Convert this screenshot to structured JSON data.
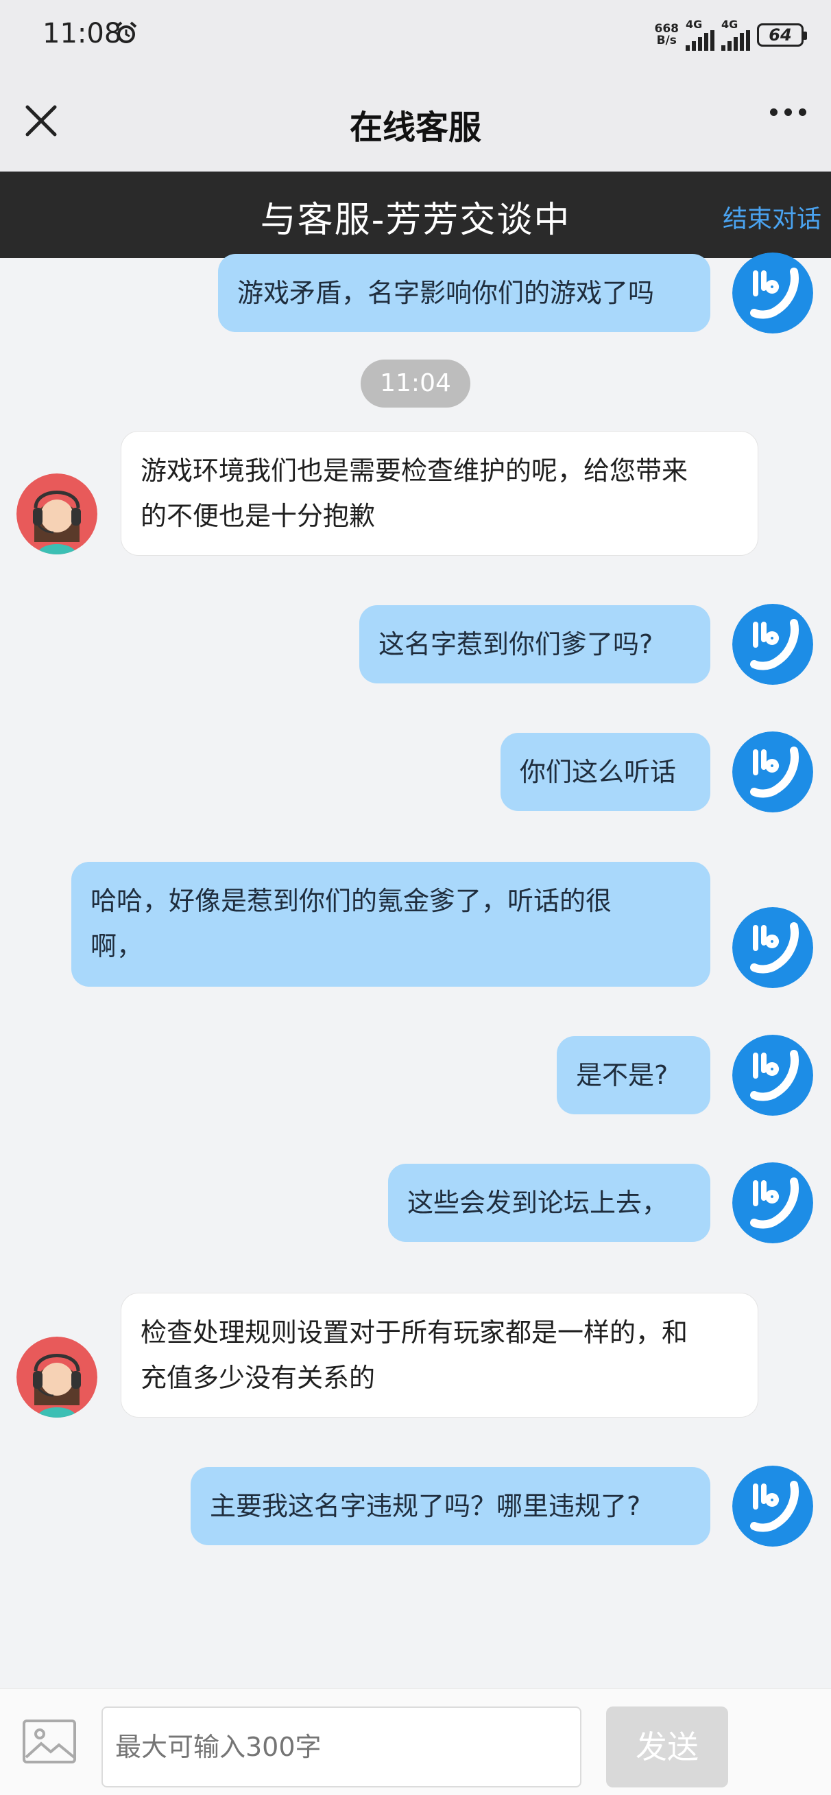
{
  "status_bar": {
    "time": "11:08",
    "net_speed_value": "668",
    "net_speed_unit": "B/s",
    "sim1": "4G",
    "sim2": "4G",
    "battery": "64"
  },
  "header": {
    "title": "在线客服",
    "close_icon": "close-icon",
    "more_icon": "more-icon"
  },
  "banner": {
    "text": "与客服-芳芳交谈中",
    "end_label": "结束对话"
  },
  "colors": {
    "user_bubble": "#a9d8fb",
    "agent_bubble": "#ffffff",
    "banner_bg": "#2a2a2a",
    "accent": "#4aa3f0"
  },
  "messages": [
    {
      "sender": "user",
      "text": "游戏矛盾，名字影响你们的游戏了吗"
    },
    {
      "type": "time",
      "text": "11:04"
    },
    {
      "sender": "agent",
      "line1": "游戏环境我们也是需要检查维护的呢，给您带来",
      "line2": "的不便也是十分抱歉"
    },
    {
      "sender": "user",
      "text": "这名字惹到你们爹了吗?"
    },
    {
      "sender": "user",
      "text": "你们这么听话"
    },
    {
      "sender": "user",
      "line1": "哈哈，好像是惹到你们的氪金爹了，听话的很",
      "line2": "啊，"
    },
    {
      "sender": "user",
      "text": "是不是?"
    },
    {
      "sender": "user",
      "text": "这些会发到论坛上去，"
    },
    {
      "sender": "agent",
      "line1": "检查处理规则设置对于所有玩家都是一样的，和",
      "line2": "充值多少没有关系的"
    },
    {
      "sender": "user",
      "text": "主要我这名字违规了吗？哪里违规了?"
    }
  ],
  "input_bar": {
    "image_icon": "image-icon",
    "placeholder": "最大可输入300字",
    "send_label": "发送"
  }
}
